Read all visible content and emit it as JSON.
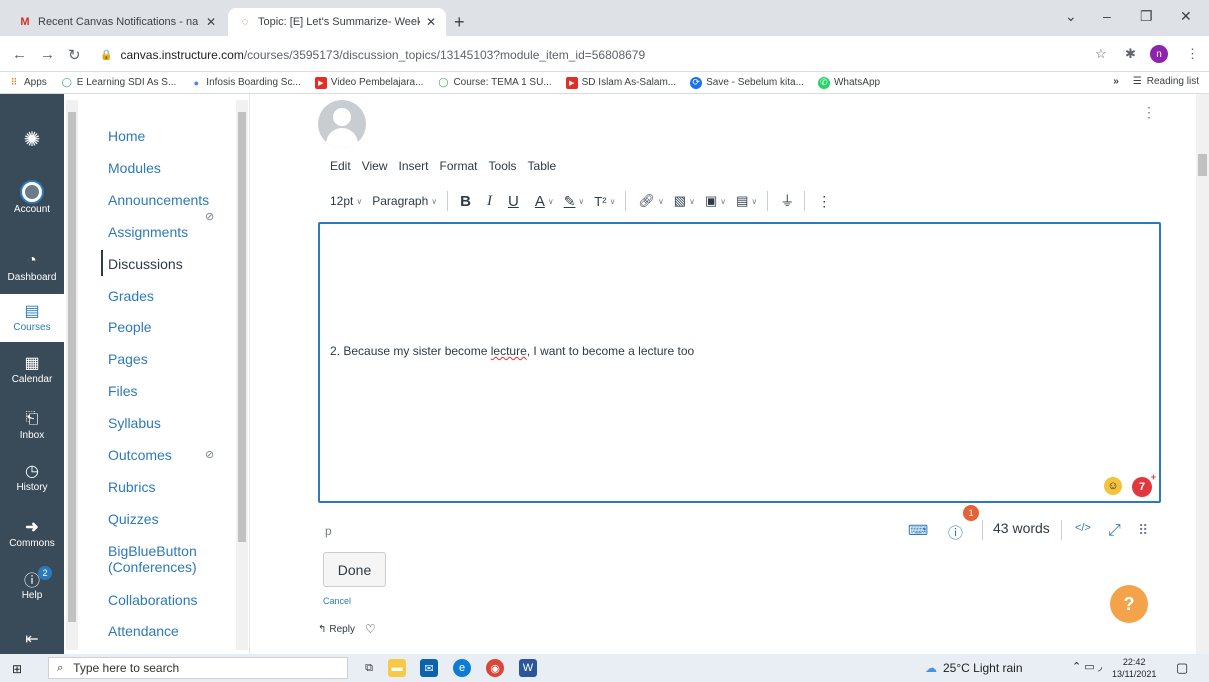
{
  "browser": {
    "tabs": [
      {
        "title": "Recent Canvas Notifications - na",
        "icon": "gmail-icon"
      },
      {
        "title": "Topic: [E] Let's Summarize- Week",
        "icon": "canvas-icon"
      }
    ],
    "url_domain": "canvas.instructure.com",
    "url_path": "/courses/3595173/discussion_topics/13145103?module_item_id=56808679",
    "profile_initial": "n",
    "bookmarks": [
      {
        "label": "Apps",
        "icon": "apps-grid-icon"
      },
      {
        "label": "E Learning SDI As S...",
        "icon": "globe-icon"
      },
      {
        "label": "Infosis Boarding Sc...",
        "icon": "map-pin-icon"
      },
      {
        "label": "Video Pembelajara...",
        "icon": "youtube-icon"
      },
      {
        "label": "Course: TEMA 1 SU...",
        "icon": "globe-icon"
      },
      {
        "label": "SD Islam As-Salam...",
        "icon": "youtube-icon"
      },
      {
        "label": "Save - Sebelum kita...",
        "icon": "save-icon"
      },
      {
        "label": "WhatsApp",
        "icon": "whatsapp-icon"
      }
    ],
    "more_bookmarks": "»",
    "reading_list": "Reading list"
  },
  "global_nav": {
    "account": "Account",
    "dashboard": "Dashboard",
    "courses": "Courses",
    "calendar": "Calendar",
    "inbox": "Inbox",
    "history": "History",
    "commons": "Commons",
    "help": "Help",
    "help_badge": "2"
  },
  "course_nav": {
    "items": [
      "Home",
      "Modules",
      "Announcements",
      "Assignments",
      "Discussions",
      "Grades",
      "People",
      "Pages",
      "Files",
      "Syllabus",
      "Outcomes",
      "Rubrics",
      "Quizzes",
      "BigBlueButton",
      "(Conferences)",
      "Collaborations",
      "Attendance"
    ]
  },
  "editor": {
    "menu": [
      "Edit",
      "View",
      "Insert",
      "Format",
      "Tools",
      "Table"
    ],
    "font_size": "12pt",
    "block_format": "Paragraph",
    "bold": "B",
    "italic": "I",
    "underline": "U",
    "text_color": "A",
    "superscript": "T²",
    "body_prefix": "2. Because my sister become ",
    "body_misspelled": "lecture",
    "body_suffix": ", I want to become a lecture too",
    "status_path": "p",
    "a11y_badge": "1",
    "word_count": "43 words",
    "html_toggle": "</>"
  },
  "actions": {
    "done": "Done",
    "cancel": "Cancel",
    "reply": "Reply"
  },
  "grammarly_count": "7",
  "taskbar": {
    "search_placeholder": "Type here to search",
    "weather": "25°C  Light rain",
    "time": "22:42",
    "date": "13/11/2021"
  },
  "colors": {
    "canvas_nav": "#394b58",
    "link": "#2d7ab8",
    "editor_focus": "#2b7abc",
    "help_fab": "#f5a34a"
  }
}
